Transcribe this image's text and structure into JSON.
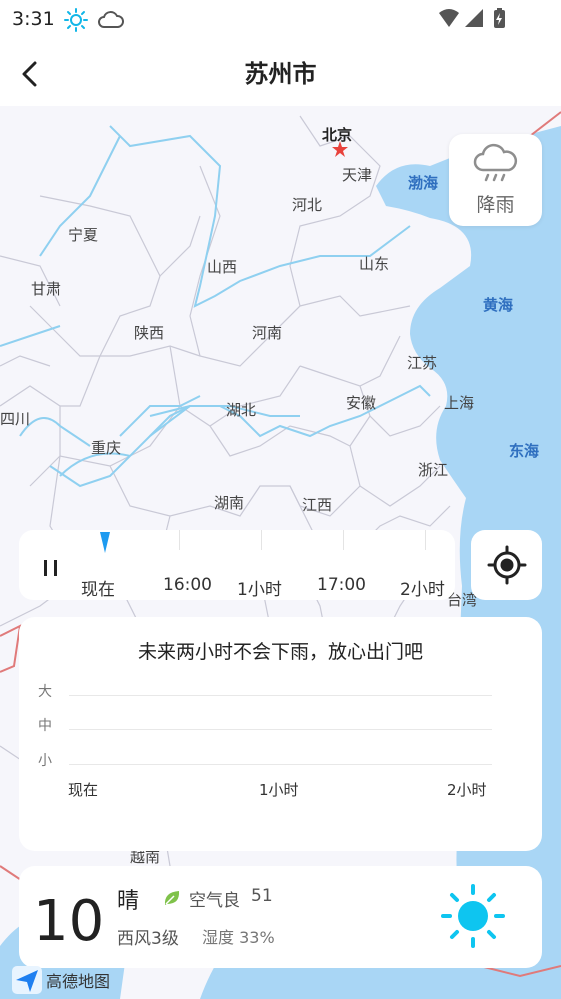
{
  "status_bar": {
    "time": "3:31",
    "icons": [
      "sun-icon",
      "cloud-icon",
      "wifi-icon",
      "signal-icon",
      "battery-icon"
    ]
  },
  "header": {
    "title": "苏州市",
    "back_icon": "chevron-left-icon"
  },
  "map": {
    "provinces": [
      {
        "name": "北京",
        "style": "cap"
      },
      {
        "name": "天津",
        "style": "normal"
      },
      {
        "name": "渤海",
        "style": "sea"
      },
      {
        "name": "河北",
        "style": "normal"
      },
      {
        "name": "宁夏",
        "style": "normal"
      },
      {
        "name": "山西",
        "style": "normal"
      },
      {
        "name": "山东",
        "style": "normal"
      },
      {
        "name": "甘肃",
        "style": "normal"
      },
      {
        "name": "黄海",
        "style": "sea"
      },
      {
        "name": "陕西",
        "style": "normal"
      },
      {
        "name": "河南",
        "style": "normal"
      },
      {
        "name": "江苏",
        "style": "normal"
      },
      {
        "name": "四川",
        "style": "normal"
      },
      {
        "name": "湖北",
        "style": "normal"
      },
      {
        "name": "安徽",
        "style": "normal"
      },
      {
        "name": "上海",
        "style": "normal"
      },
      {
        "name": "东海",
        "style": "sea"
      },
      {
        "name": "重庆",
        "style": "normal"
      },
      {
        "name": "浙江",
        "style": "normal"
      },
      {
        "name": "湖南",
        "style": "normal"
      },
      {
        "name": "江西",
        "style": "normal"
      },
      {
        "name": "台湾",
        "style": "normal"
      },
      {
        "name": "越南",
        "style": "normal"
      }
    ],
    "colors": {
      "land": "#f6f6fb",
      "sea": "#a9d6f5",
      "border": "#c9c9d6",
      "river": "#8fd0f0",
      "capital_star": "#e8423c"
    }
  },
  "rain_button": {
    "label": "降雨",
    "icon": "rain-cloud-icon"
  },
  "timeline": {
    "play_icon": "pause-icon",
    "labels": [
      "现在",
      "16:00",
      "1小时",
      "17:00",
      "2小时"
    ],
    "marker_color": "#1e9bf0"
  },
  "locate_button": {
    "icon": "locate-target-icon"
  },
  "forecast": {
    "message": "未来两小时不会下雨，放心出门吧",
    "y_labels": [
      "大",
      "中",
      "小"
    ],
    "x_labels": [
      "现在",
      "1小时",
      "2小时"
    ]
  },
  "weather": {
    "temperature": "10",
    "condition": "晴",
    "aqi_label": "空气良",
    "aqi_value": "51",
    "wind": "西风3级",
    "humidity": "湿度 33%",
    "icon": "sun-icon",
    "accent": "#0ec5f0"
  },
  "logo": {
    "text": "高德地图",
    "icon": "amap-arrow-icon"
  }
}
